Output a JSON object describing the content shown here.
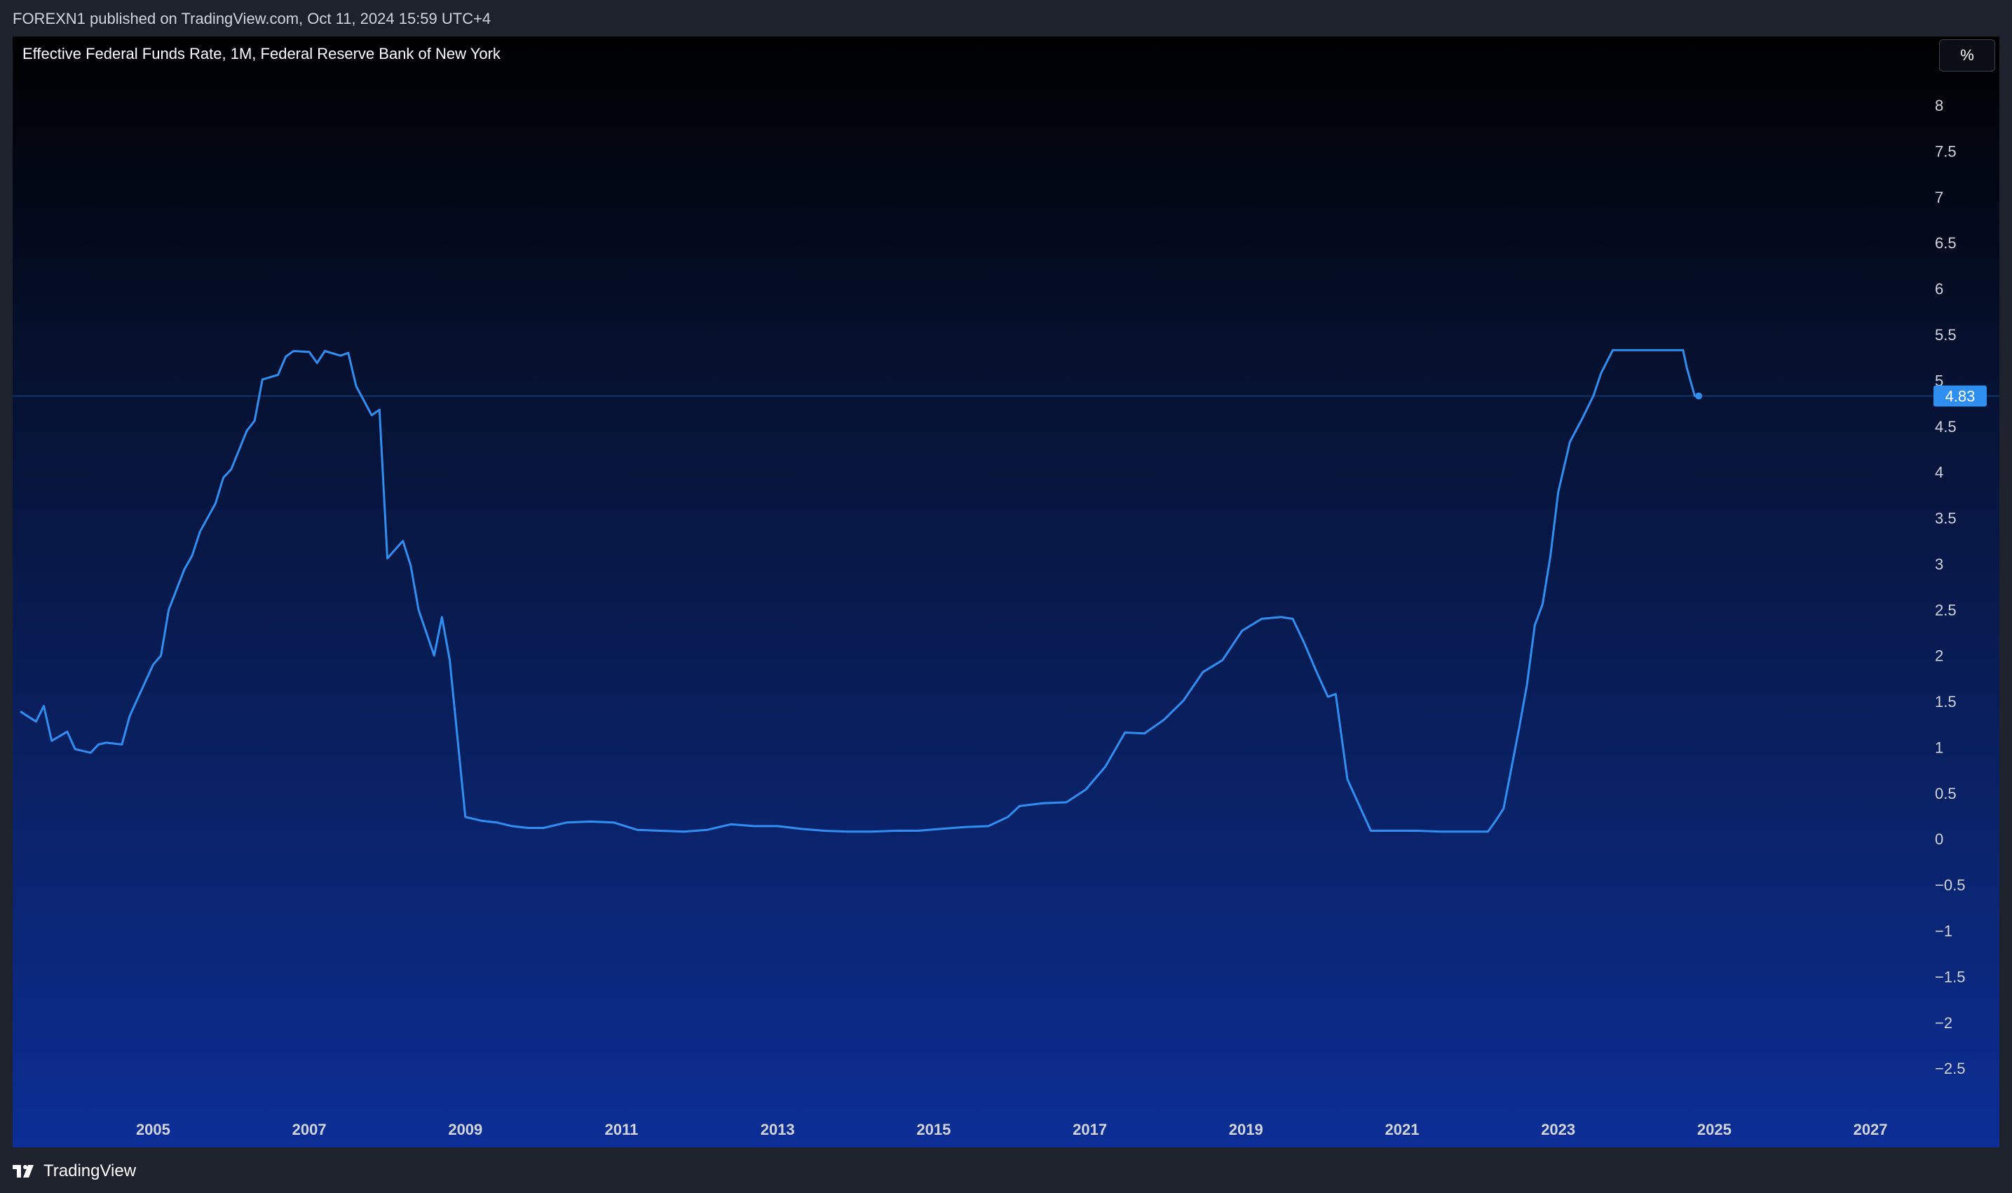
{
  "header": {
    "published_text": "FOREXN1 published on TradingView.com, Oct 11, 2024 15:59 UTC+4"
  },
  "chart": {
    "title": "Effective Federal Funds Rate, 1M, Federal Reserve Bank of New York",
    "unit_button": "%",
    "last_value_label": "4.83"
  },
  "footer": {
    "brand": "TradingView"
  },
  "colors": {
    "line": "#2f8ff0",
    "last_value_badge": "#2f8ff0",
    "background_top": "#000000",
    "background_bottom": "#0c2e96"
  },
  "chart_data": {
    "type": "line",
    "title": "Effective Federal Funds Rate, 1M, Federal Reserve Bank of New York",
    "xlabel": "",
    "ylabel": "",
    "xlim": [
      2003.2,
      2027.7
    ],
    "ylim": [
      -2.95,
      8.75
    ],
    "grid": false,
    "y_ticks": [
      "8",
      "7.5",
      "7",
      "6.5",
      "6",
      "5.5",
      "5",
      "4.5",
      "4",
      "3.5",
      "3",
      "2.5",
      "2",
      "1.5",
      "1",
      "0.5",
      "0",
      "−0.5",
      "−1",
      "−1.5",
      "−2",
      "−2.5"
    ],
    "x_ticks": [
      "2005",
      "2007",
      "2009",
      "2011",
      "2013",
      "2015",
      "2017",
      "2019",
      "2021",
      "2023",
      "2025",
      "2027"
    ],
    "last_value": 4.83,
    "series": [
      {
        "x": [
          2003.3,
          2003.5,
          2003.6,
          2003.7,
          2003.9,
          2004.0,
          2004.2,
          2004.3,
          2004.4,
          2004.6,
          2004.7,
          2004.8,
          2005.0,
          2005.1,
          2005.2,
          2005.4,
          2005.5,
          2005.6,
          2005.8,
          2005.9,
          2006.0,
          2006.2,
          2006.3,
          2006.4,
          2006.6,
          2006.7,
          2006.8,
          2007.0,
          2007.1,
          2007.2,
          2007.4,
          2007.5,
          2007.6,
          2007.8,
          2007.9,
          2008.0,
          2008.2,
          2008.3,
          2008.4,
          2008.6,
          2008.7,
          2008.8,
          2009.0,
          2009.2,
          2009.4,
          2009.6,
          2009.8,
          2010.0,
          2010.3,
          2010.6,
          2010.9,
          2011.2,
          2011.5,
          2011.8,
          2012.1,
          2012.4,
          2012.7,
          2013.0,
          2013.3,
          2013.6,
          2013.9,
          2014.2,
          2014.5,
          2014.8,
          2015.1,
          2015.4,
          2015.7,
          2015.95,
          2016.1,
          2016.4,
          2016.7,
          2016.95,
          2017.2,
          2017.45,
          2017.7,
          2017.95,
          2018.2,
          2018.45,
          2018.7,
          2018.95,
          2019.2,
          2019.45,
          2019.6,
          2019.75,
          2019.9,
          2020.05,
          2020.15,
          2020.3,
          2020.6,
          2020.9,
          2021.2,
          2021.5,
          2021.8,
          2022.1,
          2022.2,
          2022.3,
          2022.4,
          2022.5,
          2022.6,
          2022.7,
          2022.8,
          2022.9,
          2023.0,
          2023.15,
          2023.3,
          2023.45,
          2023.55,
          2023.7,
          2024.0,
          2024.3,
          2024.6,
          2024.65,
          2024.75,
          2024.8
        ],
        "y": [
          1.39,
          1.28,
          1.45,
          1.07,
          1.17,
          0.98,
          0.94,
          1.03,
          1.05,
          1.03,
          1.34,
          1.53,
          1.9,
          2.0,
          2.5,
          2.94,
          3.09,
          3.35,
          3.66,
          3.94,
          4.03,
          4.45,
          4.56,
          5.01,
          5.06,
          5.26,
          5.32,
          5.31,
          5.19,
          5.32,
          5.27,
          5.3,
          4.94,
          4.62,
          4.68,
          3.06,
          3.25,
          2.98,
          2.5,
          2.0,
          2.42,
          1.95,
          0.24,
          0.2,
          0.18,
          0.14,
          0.12,
          0.12,
          0.18,
          0.19,
          0.18,
          0.1,
          0.09,
          0.08,
          0.1,
          0.16,
          0.14,
          0.14,
          0.11,
          0.09,
          0.08,
          0.08,
          0.09,
          0.09,
          0.11,
          0.13,
          0.14,
          0.24,
          0.36,
          0.39,
          0.4,
          0.54,
          0.79,
          1.16,
          1.15,
          1.3,
          1.51,
          1.82,
          1.95,
          2.27,
          2.4,
          2.42,
          2.4,
          2.13,
          1.83,
          1.55,
          1.58,
          0.65,
          0.09,
          0.09,
          0.09,
          0.08,
          0.08,
          0.08,
          0.2,
          0.33,
          0.77,
          1.21,
          1.68,
          2.33,
          2.56,
          3.08,
          3.78,
          4.33,
          4.57,
          4.83,
          5.08,
          5.33,
          5.33,
          5.33,
          5.33,
          5.13,
          4.83,
          4.83
        ]
      }
    ]
  }
}
